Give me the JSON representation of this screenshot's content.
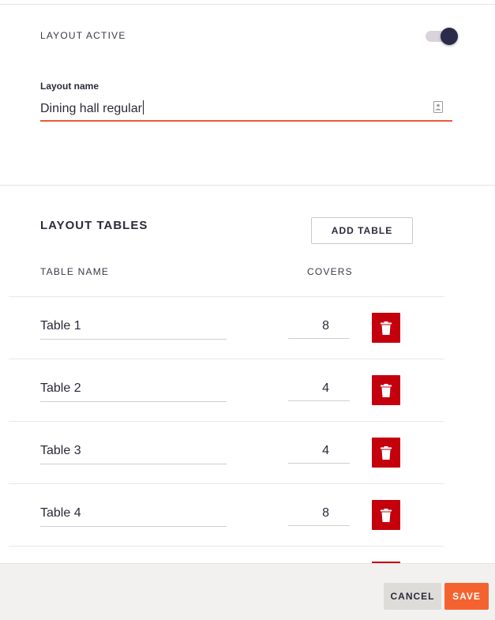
{
  "layout_active": {
    "label": "LAYOUT ACTIVE",
    "enabled": true
  },
  "layout_name": {
    "label": "Layout name",
    "value": "Dining hall regular"
  },
  "tables": {
    "title": "LAYOUT TABLES",
    "add_button": "ADD TABLE",
    "col_name": "TABLE NAME",
    "col_covers": "COVERS",
    "rows": [
      {
        "name": "Table 1",
        "covers": "8"
      },
      {
        "name": "Table 2",
        "covers": "4"
      },
      {
        "name": "Table 3",
        "covers": "4"
      },
      {
        "name": "Table 4",
        "covers": "8"
      }
    ],
    "delete_icon": "trash-icon"
  },
  "footer": {
    "cancel": "CANCEL",
    "save": "SAVE"
  },
  "colors": {
    "accent": "#f4632f",
    "danger": "#c4000d",
    "toggle_knob": "#2a2b4a"
  }
}
